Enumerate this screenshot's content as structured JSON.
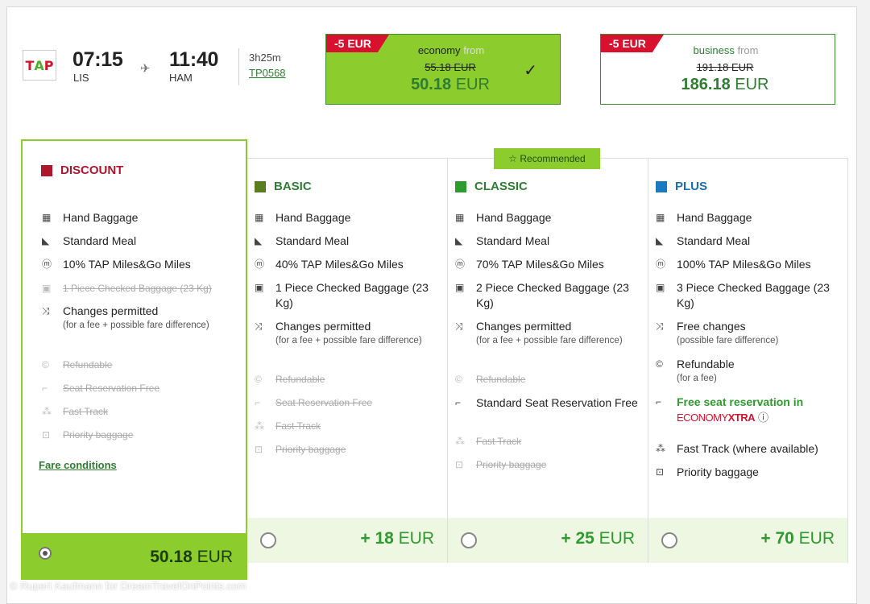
{
  "flight": {
    "airline_logo": "TAP",
    "dep_time": "07:15",
    "dep_airport": "LIS",
    "arr_time": "11:40",
    "arr_airport": "HAM",
    "duration": "3h25m",
    "flight_number": "TP0568"
  },
  "cabins": {
    "economy": {
      "discount": "-5 EUR",
      "name": "economy",
      "from": "from",
      "old_price": "55.18 EUR",
      "price_num": "50.18",
      "price_cur": "EUR",
      "selected": true
    },
    "business": {
      "discount": "-5 EUR",
      "name": "business",
      "from": "from",
      "old_price": "191.18 EUR",
      "price_num": "186.18",
      "price_cur": "EUR",
      "selected": false
    }
  },
  "recommended_label": "Recommended",
  "fares": {
    "discount": {
      "title": "DISCOUNT",
      "color": "#b0152e",
      "items": [
        {
          "icon": "hand-baggage-icon",
          "text": "Hand Baggage"
        },
        {
          "icon": "meal-icon",
          "text": "Standard Meal"
        },
        {
          "icon": "miles-icon",
          "text": "10% TAP Miles&Go Miles"
        },
        {
          "icon": "checked-baggage-icon",
          "text": "1 Piece Checked Baggage (23 Kg)"
        },
        {
          "icon": "changes-icon",
          "text": "Changes permitted",
          "sub": "(for a fee + possible fare difference)"
        },
        {
          "icon": "refund-icon",
          "text": "Refundable"
        },
        {
          "icon": "seat-icon",
          "text": "Seat Reservation Free"
        },
        {
          "icon": "fast-track-icon",
          "text": "Fast Track"
        },
        {
          "icon": "priority-icon",
          "text": "Priority baggage"
        }
      ],
      "link": "Fare conditions",
      "price_num": "50.18",
      "price_cur": "EUR"
    },
    "basic": {
      "title": "BASIC",
      "color": "#5a7d1e",
      "items": [
        {
          "text": "Hand Baggage"
        },
        {
          "text": "Standard Meal"
        },
        {
          "text": "40% TAP Miles&Go Miles"
        },
        {
          "text": "1 Piece Checked Baggage (23 Kg)"
        },
        {
          "text": "Changes permitted",
          "sub": "(for a fee + possible fare difference)"
        },
        {
          "text": "Refundable"
        },
        {
          "text": "Seat Reservation Free"
        },
        {
          "text": "Fast Track"
        },
        {
          "text": "Priority baggage"
        }
      ],
      "price_num": "+ 18",
      "price_cur": "EUR"
    },
    "classic": {
      "title": "CLASSIC",
      "color": "#2e9b2e",
      "items": [
        {
          "text": "Hand Baggage"
        },
        {
          "text": "Standard Meal"
        },
        {
          "text": "70% TAP Miles&Go Miles"
        },
        {
          "text": "2 Piece Checked Baggage (23 Kg)"
        },
        {
          "text": "Changes permitted",
          "sub": "(for a fee + possible fare difference)"
        },
        {
          "text": "Refundable"
        },
        {
          "text": "Standard Seat Reservation Free"
        },
        {
          "text": "Fast Track"
        },
        {
          "text": "Priority baggage"
        }
      ],
      "price_num": "+ 25",
      "price_cur": "EUR"
    },
    "plus": {
      "title": "PLUS",
      "color": "#1a7abf",
      "items": [
        {
          "text": "Hand Baggage"
        },
        {
          "text": "Standard Meal"
        },
        {
          "text": "100% TAP Miles&Go Miles"
        },
        {
          "text": "3 Piece Checked Baggage (23 Kg)"
        },
        {
          "text": "Free changes",
          "sub": "(possible fare difference)"
        },
        {
          "text": "Refundable",
          "sub": "(for a fee)"
        },
        {
          "text": "Free seat reservation in",
          "extra1": "ECONOMY",
          "extra2": "XTRA"
        },
        {
          "text": "Fast Track (where available)"
        },
        {
          "text": "Priority baggage"
        }
      ],
      "price_num": "+ 70",
      "price_cur": "EUR"
    }
  },
  "watermark": "© Rupert Kaufmann for DreamTravelOnPoints.com"
}
